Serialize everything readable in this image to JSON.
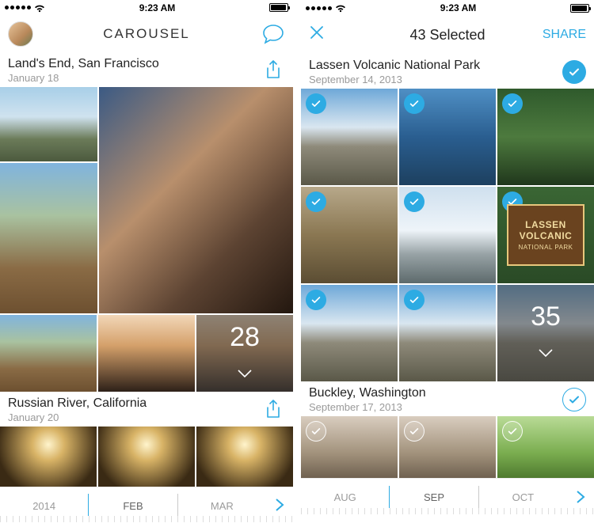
{
  "colors": {
    "accent": "#2dabe3"
  },
  "status": {
    "time": "9:23 AM"
  },
  "left": {
    "nav": {
      "title": "CAROUSEL"
    },
    "sections": [
      {
        "location": "Land's End, San Francisco",
        "date": "January 18",
        "more_count": "28"
      },
      {
        "location": "Russian River, California",
        "date": "January 20"
      }
    ],
    "timeline": {
      "labels": [
        "2014",
        "FEB",
        "MAR"
      ],
      "current_index": 1
    }
  },
  "right": {
    "nav": {
      "title": "43 Selected",
      "share": "SHARE"
    },
    "sections": [
      {
        "location": "Lassen Volcanic National Park",
        "date": "September 14, 2013",
        "sign": {
          "line1": "LASSEN",
          "line2": "VOLCANIC",
          "line3": "NATIONAL PARK"
        },
        "more_count": "35"
      },
      {
        "location": "Buckley, Washington",
        "date": "September 17, 2013"
      }
    ],
    "timeline": {
      "labels": [
        "AUG",
        "SEP",
        "OCT"
      ],
      "current_index": 1
    }
  }
}
